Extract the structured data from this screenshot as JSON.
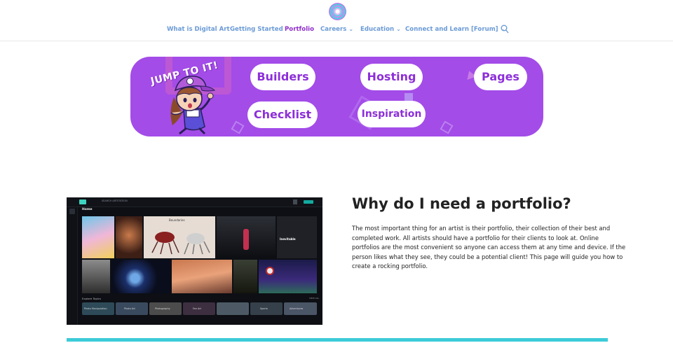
{
  "header": {
    "logo_icon": "swirl-logo-icon",
    "nav": [
      {
        "label": "What is Digital Art",
        "has_caret": false,
        "active": false
      },
      {
        "label": "Getting Started",
        "has_caret": false,
        "active": false
      },
      {
        "label": "Portfolio",
        "has_caret": false,
        "active": true
      },
      {
        "label": "Careers",
        "has_caret": true,
        "active": false
      },
      {
        "label": "Education",
        "has_caret": true,
        "active": false
      },
      {
        "label": "Connect and Learn [Forum]",
        "has_caret": true,
        "active": false
      }
    ],
    "caret_glyph": "⌄",
    "search_icon": "search-icon"
  },
  "banner": {
    "jump_text": "JUMP TO IT!",
    "buttons": [
      "Builders",
      "Hosting",
      "Pages",
      "Checklist",
      "Inspiration"
    ],
    "background_color": "#a34ce8",
    "button_text_color": "#8c2fd9"
  },
  "screenshot": {
    "search_placeholder": "SEARCH ARTSTATION",
    "home_label": "Home",
    "feature_title": "Boundaries",
    "feature_side_title": "Inevitable",
    "explore_label": "Explore Topics",
    "view_all": "VIEW ALL",
    "topics": [
      "Photo Manipulation",
      "Photo Art",
      "Photography",
      "Fan Art",
      "",
      "Sports",
      "Adventures"
    ]
  },
  "content": {
    "heading": "Why do I need a portfolio?",
    "paragraph_lines": [
      "The most important thing for an artist is their portfolio, their collection of their best and",
      "completed work. All artists should have a portfolio for their clients to look at. Online",
      "portfolios are the most convenient so anyone can access them at any time and device. If the",
      "person likes what they see, they could be a potential client! This page will guide you how to",
      "create a rocking portfolio."
    ],
    "accent_color": "#3ccbd8"
  }
}
